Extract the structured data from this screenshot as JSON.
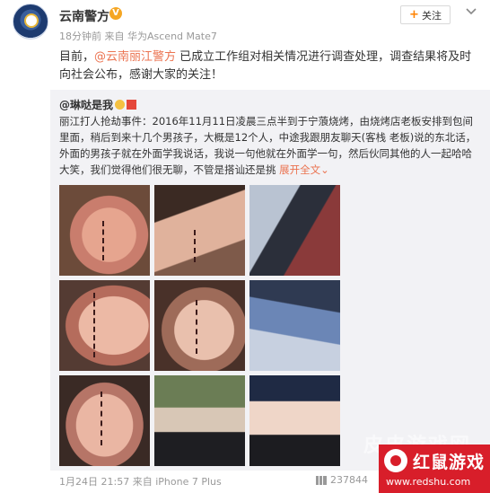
{
  "header": {
    "username": "云南警方",
    "verified_mark": "V",
    "time": "18分钟前",
    "source_prefix": "来自",
    "device": "华为Ascend Mate7",
    "follow_label": "关注"
  },
  "post": {
    "text_prefix": "目前，",
    "mention": "@云南丽江警方",
    "text_suffix": " 已成立工作组对相关情况进行调查处理，调查结果将及时向社会公布，感谢大家的关注！"
  },
  "repost": {
    "author": "@琳哒是我",
    "text": "丽江打人抢劫事件：2016年11月11日凌晨三点半到于宁蒗烧烤，由烧烤店老板安排到包间里面，稍后到来十几个男孩子，大概是12个人，中途我跟朋友聊天(客栈 老板)说的东北话，外面的男孩子就在外面学我说话，我说一句他就在外面学一句，然后伙同其他的人一起哈哈大笑，我们觉得他们很无聊，不管是搭讪还是挑",
    "expand_label": "展开全文",
    "expand_arrow": "⌄",
    "images": [
      "photo-1",
      "photo-2",
      "photo-3",
      "photo-4",
      "photo-5",
      "photo-6",
      "photo-7",
      "photo-8",
      "photo-9"
    ]
  },
  "footer": {
    "date": "1月24日 21:57",
    "source_prefix": "来自",
    "device": "iPhone 7 Plus",
    "views": "237844"
  },
  "watermark": {
    "faded_text": "皮皮游戏网",
    "title": "红鼠游戏",
    "url": "www.redshu.com"
  },
  "colors": {
    "link": "#eb7350",
    "watermark_red": "#d81e2a",
    "verified": "#f5a623"
  }
}
